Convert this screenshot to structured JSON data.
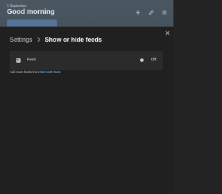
{
  "board": {
    "date": "1 September",
    "greeting": "Good morning"
  },
  "modal": {
    "breadcrumb_root": "Settings",
    "breadcrumb_current": "Show or hide feeds",
    "feed": {
      "label": "Feed",
      "toggle_state": "Off"
    },
    "store_prefix": "Add more feeds from",
    "store_link": "Microsoft Store"
  },
  "colors": {
    "accent_link": "#8fd1ff",
    "modal_bg": "#202020",
    "row_bg": "#2b2b2b"
  }
}
